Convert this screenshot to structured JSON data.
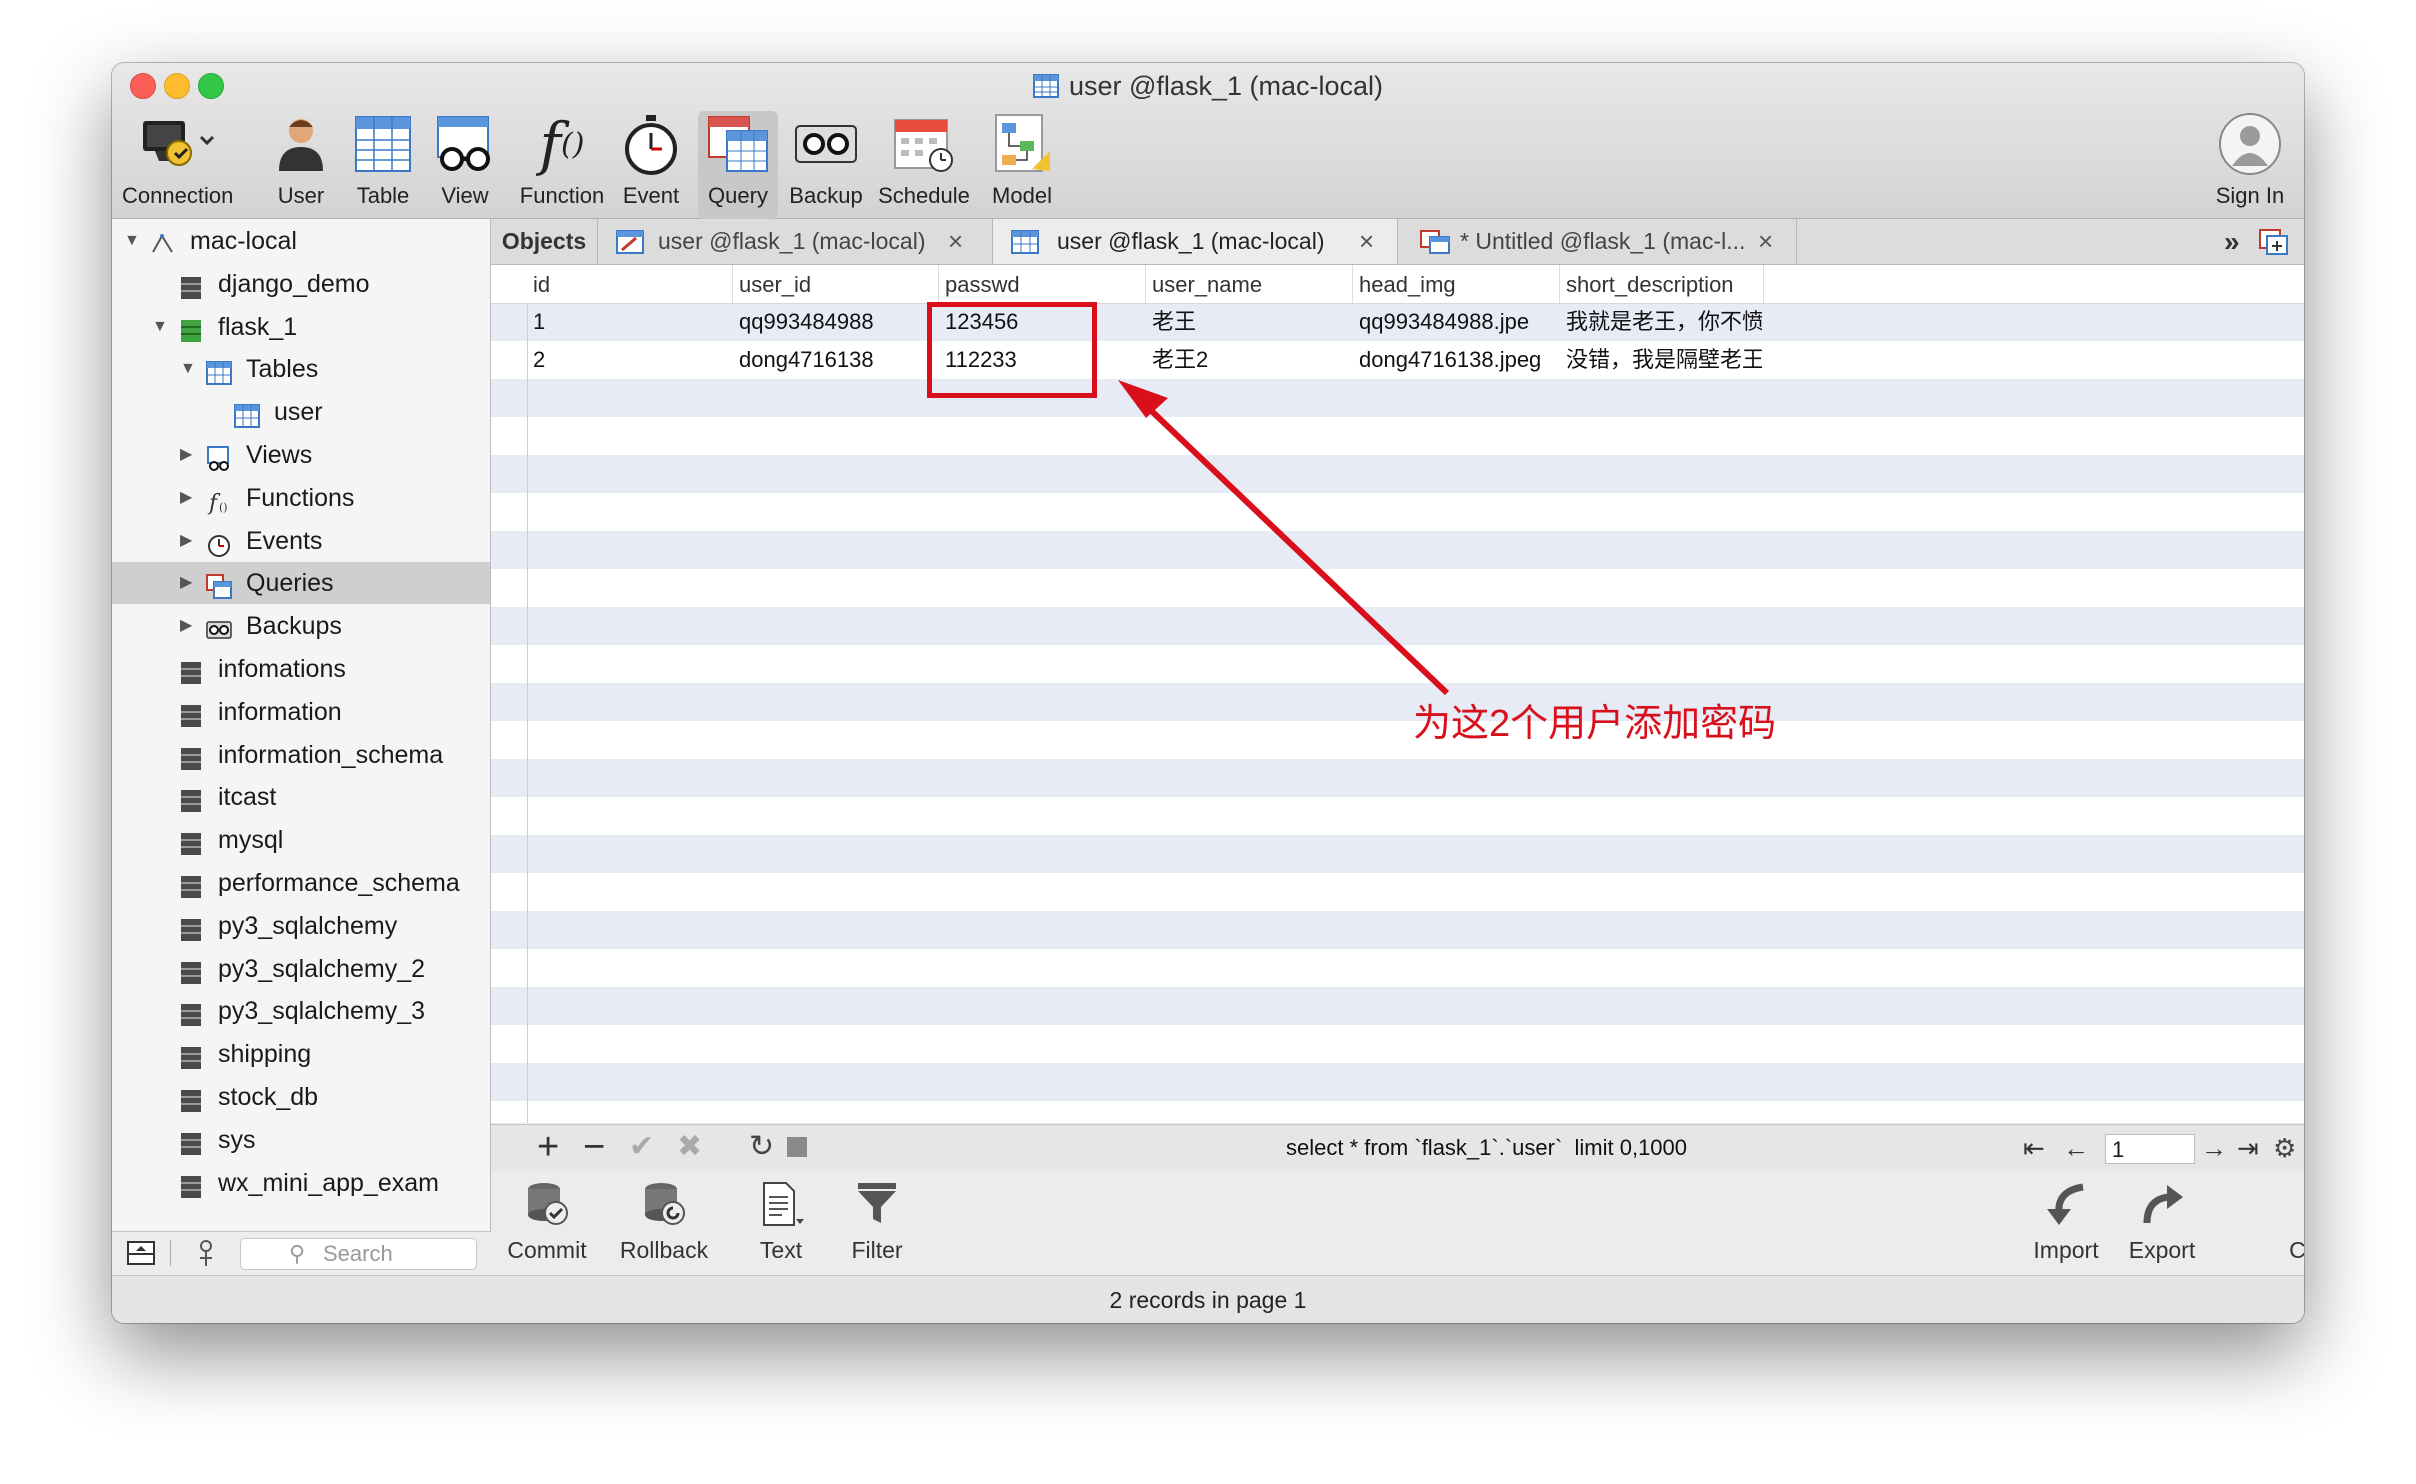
{
  "window": {
    "title": "user @flask_1 (mac-local)",
    "traffic_lights": [
      "#fc5f57",
      "#fdbc2e",
      "#33c748"
    ]
  },
  "toolbar": {
    "items": [
      {
        "label": "Connection",
        "icon": "connection-icon"
      },
      {
        "label": "User",
        "icon": "user-icon"
      },
      {
        "label": "Table",
        "icon": "table-icon"
      },
      {
        "label": "View",
        "icon": "view-icon"
      },
      {
        "label": "Function",
        "icon": "function-icon"
      },
      {
        "label": "Event",
        "icon": "event-clock-icon"
      },
      {
        "label": "Query",
        "icon": "query-icon",
        "selected": true
      },
      {
        "label": "Backup",
        "icon": "backup-icon"
      },
      {
        "label": "Schedule",
        "icon": "schedule-calendar-icon"
      },
      {
        "label": "Model",
        "icon": "model-icon"
      }
    ],
    "sign_in": "Sign In"
  },
  "sidebar": {
    "nodes": [
      {
        "label": "mac-local",
        "icon": "connection-icon",
        "expanded": true
      },
      {
        "label": "django_demo",
        "icon": "database-icon"
      },
      {
        "label": "flask_1",
        "icon": "database-open-icon",
        "expanded": true
      },
      {
        "label": "Tables",
        "icon": "tables-icon",
        "expanded": true
      },
      {
        "label": "user",
        "icon": "table-icon"
      },
      {
        "label": "Views",
        "icon": "views-icon"
      },
      {
        "label": "Functions",
        "icon": "functions-icon"
      },
      {
        "label": "Events",
        "icon": "events-icon"
      },
      {
        "label": "Queries",
        "icon": "queries-icon",
        "selected": true
      },
      {
        "label": "Backups",
        "icon": "backups-icon"
      },
      {
        "label": "infomations",
        "icon": "database-icon"
      },
      {
        "label": "information",
        "icon": "database-icon"
      },
      {
        "label": "information_schema",
        "icon": "database-icon"
      },
      {
        "label": "itcast",
        "icon": "database-icon"
      },
      {
        "label": "mysql",
        "icon": "database-icon"
      },
      {
        "label": "performance_schema",
        "icon": "database-icon"
      },
      {
        "label": "py3_sqlalchemy",
        "icon": "database-icon"
      },
      {
        "label": "py3_sqlalchemy_2",
        "icon": "database-icon"
      },
      {
        "label": "py3_sqlalchemy_3",
        "icon": "database-icon"
      },
      {
        "label": "shipping",
        "icon": "database-icon"
      },
      {
        "label": "stock_db",
        "icon": "database-icon"
      },
      {
        "label": "sys",
        "icon": "database-icon"
      },
      {
        "label": "wx_mini_app_exam",
        "icon": "database-icon"
      }
    ],
    "search_placeholder": "Search"
  },
  "tabs": {
    "objects": "Objects",
    "items": [
      {
        "label": "user @flask_1 (mac-local)",
        "active": false
      },
      {
        "label": "user @flask_1 (mac-local)",
        "active": true
      },
      {
        "label": "* Untitled @flask_1 (mac-l...",
        "active": false
      }
    ]
  },
  "grid": {
    "columns": [
      "id",
      "user_id",
      "passwd",
      "user_name",
      "head_img",
      "short_description"
    ],
    "rows": [
      [
        "1",
        "qq993484988",
        "123456",
        "老王",
        "qq993484988.jpe",
        "我就是老王，你不愤"
      ],
      [
        "2",
        "dong4716138",
        "112233",
        "老王2",
        "dong4716138.jpeg",
        "没错，我是隔壁老王"
      ]
    ]
  },
  "grid_toolbar": {
    "sql": "select * from `flask_1`.`user`  limit 0,1000",
    "page": "1"
  },
  "bottom_toolbar": {
    "commit": "Commit",
    "rollback": "Rollback",
    "text": "Text",
    "filter": "Filter",
    "import": "Import",
    "export": "Export",
    "custom_sort": "Custom Sort"
  },
  "status": "2 records in page 1",
  "annotation": {
    "text": "为这2个用户添加密码",
    "color": "#d90f1b"
  }
}
